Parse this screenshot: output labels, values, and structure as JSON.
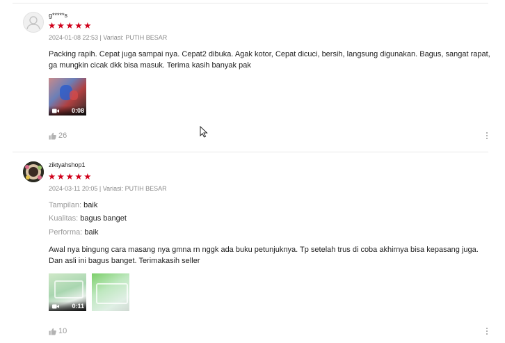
{
  "reviews": [
    {
      "username": "g*****s",
      "stars": "★★★★★",
      "meta": "2024-01-08 22:53 | Variasi: PUTIH BESAR",
      "comment": "Packing rapih. Cepat juga sampai nya. Cepat2 dibuka. Agak kotor, Cepat dicuci, bersih,  langsung digunakan. Bagus, sangat rapat, ga mungkin cicak dkk bisa masuk. Terima kasih banyak pak",
      "media": [
        {
          "type": "video",
          "duration": "0:08"
        }
      ],
      "likes": "26"
    },
    {
      "username": "ziktyahshop1",
      "stars": "★★★★★",
      "meta": "2024-03-11 20:05 | Variasi: PUTIH BESAR",
      "attributes": [
        {
          "label": "Tampilan:",
          "value": "baik"
        },
        {
          "label": "Kualitas:",
          "value": "bagus banget"
        },
        {
          "label": "Performa:",
          "value": "baik"
        }
      ],
      "comment": "Awal nya bingung cara masang nya gmna rn nggk ada buku petunjuknya. Tp setelah trus di coba akhirnya bisa kepasang juga. Dan asli ini bagus banget. Terimakasih seller",
      "media": [
        {
          "type": "video",
          "duration": "0:11"
        },
        {
          "type": "image"
        }
      ],
      "likes": "10"
    }
  ],
  "colors": {
    "star": "#d0011b",
    "muted": "#8a8a8a"
  }
}
